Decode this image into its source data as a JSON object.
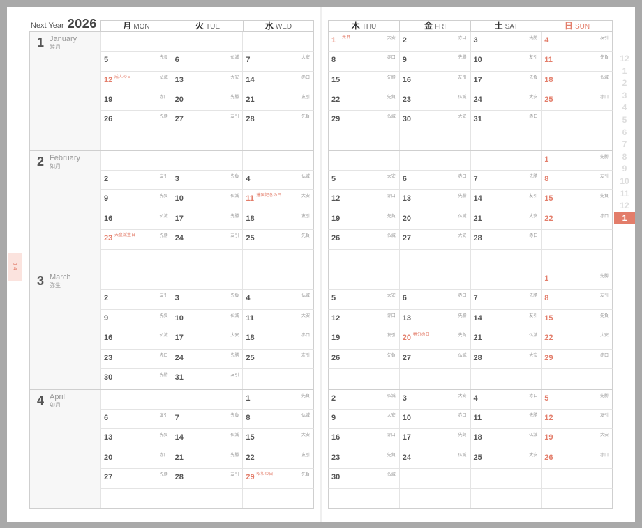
{
  "title": {
    "prefix": "Next Year",
    "year": "2026"
  },
  "headers_left": [
    {
      "kanji": "月",
      "en": "MON",
      "sun": false
    },
    {
      "kanji": "火",
      "en": "TUE",
      "sun": false
    },
    {
      "kanji": "水",
      "en": "WED",
      "sun": false
    }
  ],
  "headers_right": [
    {
      "kanji": "木",
      "en": "THU",
      "sun": false
    },
    {
      "kanji": "金",
      "en": "FRI",
      "sun": false
    },
    {
      "kanji": "土",
      "en": "SAT",
      "sun": false
    },
    {
      "kanji": "日",
      "en": "SUN",
      "sun": true
    }
  ],
  "tab_label": "1-4",
  "month_index": [
    "12",
    "1",
    "2",
    "3",
    "4",
    "5",
    "6",
    "7",
    "8",
    "9",
    "10",
    "11",
    "12",
    "1"
  ],
  "month_index_active": 13,
  "months": [
    {
      "num": "1",
      "en": "January",
      "jp": "睦月",
      "left": [
        [
          null,
          null,
          null
        ],
        [
          {
            "d": "5",
            "r": "先負"
          },
          {
            "d": "6",
            "r": "仏滅"
          },
          {
            "d": "7",
            "r": "大安"
          }
        ],
        [
          {
            "d": "12",
            "r": "仏滅",
            "red": true,
            "h": "成人の日"
          },
          {
            "d": "13",
            "r": "大安"
          },
          {
            "d": "14",
            "r": "赤口"
          }
        ],
        [
          {
            "d": "19",
            "r": "赤口"
          },
          {
            "d": "20",
            "r": "先勝"
          },
          {
            "d": "21",
            "r": "友引"
          }
        ],
        [
          {
            "d": "26",
            "r": "先勝"
          },
          {
            "d": "27",
            "r": "友引"
          },
          {
            "d": "28",
            "r": "先負"
          }
        ],
        [
          null,
          null,
          null
        ]
      ],
      "right": [
        [
          {
            "d": "1",
            "r": "大安",
            "red": true,
            "h": "元日"
          },
          {
            "d": "2",
            "r": "赤口"
          },
          {
            "d": "3",
            "r": "先勝"
          },
          {
            "d": "4",
            "r": "友引",
            "red": true
          }
        ],
        [
          {
            "d": "8",
            "r": "赤口"
          },
          {
            "d": "9",
            "r": "先勝"
          },
          {
            "d": "10",
            "r": "友引"
          },
          {
            "d": "11",
            "r": "先負",
            "red": true
          }
        ],
        [
          {
            "d": "15",
            "r": "先勝"
          },
          {
            "d": "16",
            "r": "友引"
          },
          {
            "d": "17",
            "r": "先負"
          },
          {
            "d": "18",
            "r": "仏滅",
            "red": true
          }
        ],
        [
          {
            "d": "22",
            "r": "先負"
          },
          {
            "d": "23",
            "r": "仏滅"
          },
          {
            "d": "24",
            "r": "大安"
          },
          {
            "d": "25",
            "r": "赤口",
            "red": true
          }
        ],
        [
          {
            "d": "29",
            "r": "仏滅"
          },
          {
            "d": "30",
            "r": "大安"
          },
          {
            "d": "31",
            "r": "赤口"
          },
          null
        ],
        [
          null,
          null,
          null,
          null
        ]
      ]
    },
    {
      "num": "2",
      "en": "February",
      "jp": "如月",
      "left": [
        [
          null,
          null,
          null
        ],
        [
          {
            "d": "2",
            "r": "友引"
          },
          {
            "d": "3",
            "r": "先負"
          },
          {
            "d": "4",
            "r": "仏滅"
          }
        ],
        [
          {
            "d": "9",
            "r": "先負"
          },
          {
            "d": "10",
            "r": "仏滅"
          },
          {
            "d": "11",
            "r": "大安",
            "red": true,
            "h": "建国記念の日"
          }
        ],
        [
          {
            "d": "16",
            "r": "仏滅"
          },
          {
            "d": "17",
            "r": "先勝"
          },
          {
            "d": "18",
            "r": "友引"
          }
        ],
        [
          {
            "d": "23",
            "r": "先勝",
            "red": true,
            "h": "天皇誕生日"
          },
          {
            "d": "24",
            "r": "友引"
          },
          {
            "d": "25",
            "r": "先負"
          }
        ],
        [
          null,
          null,
          null
        ]
      ],
      "right": [
        [
          null,
          null,
          null,
          {
            "d": "1",
            "r": "先勝",
            "red": true
          }
        ],
        [
          {
            "d": "5",
            "r": "大安"
          },
          {
            "d": "6",
            "r": "赤口"
          },
          {
            "d": "7",
            "r": "先勝"
          },
          {
            "d": "8",
            "r": "友引",
            "red": true
          }
        ],
        [
          {
            "d": "12",
            "r": "赤口"
          },
          {
            "d": "13",
            "r": "先勝"
          },
          {
            "d": "14",
            "r": "友引"
          },
          {
            "d": "15",
            "r": "先負",
            "red": true
          }
        ],
        [
          {
            "d": "19",
            "r": "先負"
          },
          {
            "d": "20",
            "r": "仏滅"
          },
          {
            "d": "21",
            "r": "大安"
          },
          {
            "d": "22",
            "r": "赤口",
            "red": true
          }
        ],
        [
          {
            "d": "26",
            "r": "仏滅"
          },
          {
            "d": "27",
            "r": "大安"
          },
          {
            "d": "28",
            "r": "赤口"
          },
          null
        ],
        [
          null,
          null,
          null,
          null
        ]
      ]
    },
    {
      "num": "3",
      "en": "March",
      "jp": "弥生",
      "left": [
        [
          null,
          null,
          null
        ],
        [
          {
            "d": "2",
            "r": "友引"
          },
          {
            "d": "3",
            "r": "先負"
          },
          {
            "d": "4",
            "r": "仏滅"
          }
        ],
        [
          {
            "d": "9",
            "r": "先負"
          },
          {
            "d": "10",
            "r": "仏滅"
          },
          {
            "d": "11",
            "r": "大安"
          }
        ],
        [
          {
            "d": "16",
            "r": "仏滅"
          },
          {
            "d": "17",
            "r": "大安"
          },
          {
            "d": "18",
            "r": "赤口"
          }
        ],
        [
          {
            "d": "23",
            "r": "赤口"
          },
          {
            "d": "24",
            "r": "先勝"
          },
          {
            "d": "25",
            "r": "友引"
          }
        ],
        [
          {
            "d": "30",
            "r": "先勝"
          },
          {
            "d": "31",
            "r": "友引"
          },
          null
        ]
      ],
      "right": [
        [
          null,
          null,
          null,
          {
            "d": "1",
            "r": "先勝",
            "red": true
          }
        ],
        [
          {
            "d": "5",
            "r": "大安"
          },
          {
            "d": "6",
            "r": "赤口"
          },
          {
            "d": "7",
            "r": "先勝"
          },
          {
            "d": "8",
            "r": "友引",
            "red": true
          }
        ],
        [
          {
            "d": "12",
            "r": "赤口"
          },
          {
            "d": "13",
            "r": "先勝"
          },
          {
            "d": "14",
            "r": "友引"
          },
          {
            "d": "15",
            "r": "先負",
            "red": true
          }
        ],
        [
          {
            "d": "19",
            "r": "友引"
          },
          {
            "d": "20",
            "r": "先負",
            "red": true,
            "h": "春分の日"
          },
          {
            "d": "21",
            "r": "仏滅"
          },
          {
            "d": "22",
            "r": "大安",
            "red": true
          }
        ],
        [
          {
            "d": "26",
            "r": "先負"
          },
          {
            "d": "27",
            "r": "仏滅"
          },
          {
            "d": "28",
            "r": "大安"
          },
          {
            "d": "29",
            "r": "赤口",
            "red": true
          }
        ],
        [
          null,
          null,
          null,
          null
        ]
      ]
    },
    {
      "num": "4",
      "en": "April",
      "jp": "卯月",
      "left": [
        [
          null,
          null,
          {
            "d": "1",
            "r": "先負"
          }
        ],
        [
          {
            "d": "6",
            "r": "友引"
          },
          {
            "d": "7",
            "r": "先負"
          },
          {
            "d": "8",
            "r": "仏滅"
          }
        ],
        [
          {
            "d": "13",
            "r": "先負"
          },
          {
            "d": "14",
            "r": "仏滅"
          },
          {
            "d": "15",
            "r": "大安"
          }
        ],
        [
          {
            "d": "20",
            "r": "赤口"
          },
          {
            "d": "21",
            "r": "先勝"
          },
          {
            "d": "22",
            "r": "友引"
          }
        ],
        [
          {
            "d": "27",
            "r": "先勝"
          },
          {
            "d": "28",
            "r": "友引"
          },
          {
            "d": "29",
            "r": "先負",
            "red": true,
            "h": "昭和の日"
          }
        ],
        [
          null,
          null,
          null
        ]
      ],
      "right": [
        [
          {
            "d": "2",
            "r": "仏滅"
          },
          {
            "d": "3",
            "r": "大安"
          },
          {
            "d": "4",
            "r": "赤口"
          },
          {
            "d": "5",
            "r": "先勝",
            "red": true
          }
        ],
        [
          {
            "d": "9",
            "r": "大安"
          },
          {
            "d": "10",
            "r": "赤口"
          },
          {
            "d": "11",
            "r": "先勝"
          },
          {
            "d": "12",
            "r": "友引",
            "red": true
          }
        ],
        [
          {
            "d": "16",
            "r": "赤口"
          },
          {
            "d": "17",
            "r": "先負"
          },
          {
            "d": "18",
            "r": "仏滅"
          },
          {
            "d": "19",
            "r": "大安",
            "red": true
          }
        ],
        [
          {
            "d": "23",
            "r": "先負"
          },
          {
            "d": "24",
            "r": "仏滅"
          },
          {
            "d": "25",
            "r": "大安"
          },
          {
            "d": "26",
            "r": "赤口",
            "red": true
          }
        ],
        [
          {
            "d": "30",
            "r": "仏滅"
          },
          null,
          null,
          null
        ],
        [
          null,
          null,
          null,
          null
        ]
      ]
    }
  ]
}
